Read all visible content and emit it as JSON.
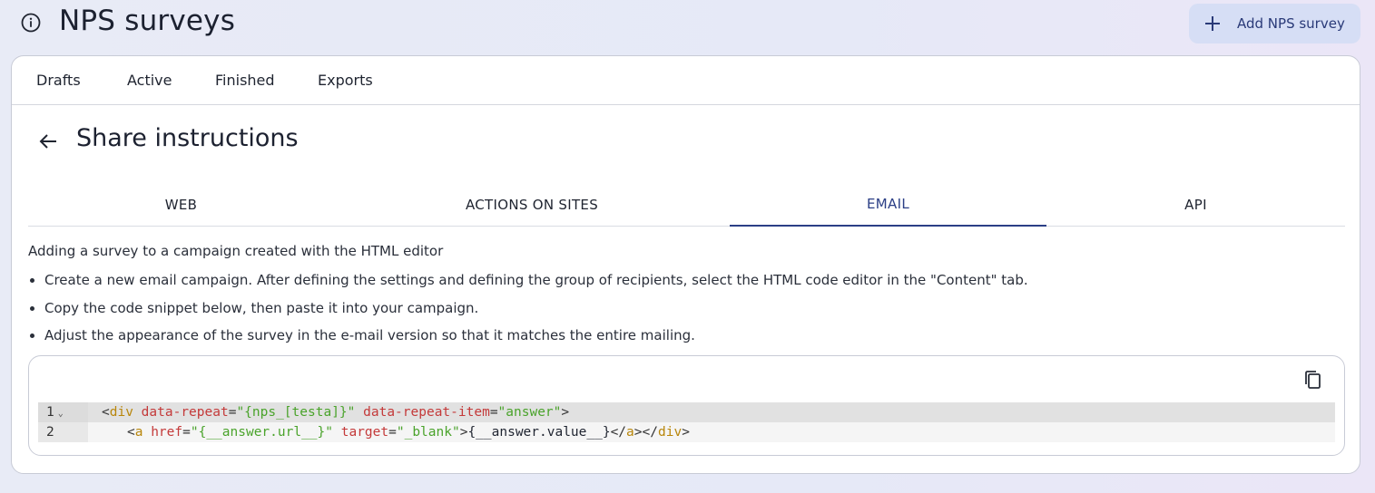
{
  "header": {
    "info_icon": "info-circle-icon",
    "title": "NPS surveys",
    "add_button": {
      "icon": "plus-icon",
      "label": "Add NPS survey"
    }
  },
  "top_tabs": [
    "Drafts",
    "Active",
    "Finished",
    "Exports"
  ],
  "section": {
    "back_icon": "arrow-left-icon",
    "title": "Share instructions"
  },
  "sub_tabs": {
    "items": [
      "WEB",
      "ACTIONS ON SITES",
      "EMAIL",
      "API"
    ],
    "active": "EMAIL"
  },
  "content": {
    "intro": "Adding a survey to a campaign created with the HTML editor",
    "steps": [
      "Create a new email campaign. After defining the settings and defining the group of recipients, select the HTML code editor in the \"Content\" tab.",
      "Copy the code snippet below, then paste it into your campaign.",
      "Adjust the appearance of the survey in the e-mail version so that it matches the entire mailing."
    ]
  },
  "code_editor": {
    "copy_icon": "copy-icon",
    "lines": [
      {
        "number": "1",
        "folded_marker": "⌄"
      },
      {
        "number": "2",
        "folded_marker": ""
      }
    ],
    "tokens": {
      "line1": {
        "open": "<",
        "tag": "div",
        "attr1": "data-repeat",
        "eq1": "=",
        "val1": "\"{nps_[testa]}\"",
        "attr2": "data-repeat-item",
        "eq2": "=",
        "val2": "\"answer\"",
        "close": ">"
      },
      "line2": {
        "open": "<",
        "tag": "a",
        "attr1": "href",
        "eq1": "=",
        "val1": "\"{__answer.url__}\"",
        "attr2": "target",
        "eq2": "=",
        "val2": "\"_blank\"",
        "close": ">",
        "text": "{__answer.value__}",
        "end_a_open": "</",
        "end_a_tag": "a",
        "end_a_close": ">",
        "end_div_open": "</",
        "end_div_tag": "div",
        "end_div_close": ">"
      }
    }
  },
  "colors": {
    "accent": "#2b3f86",
    "add_button_bg": "#d6def5",
    "code_tag": "#b8860b",
    "code_attr": "#c43a3a",
    "code_string": "#4aa32b"
  }
}
